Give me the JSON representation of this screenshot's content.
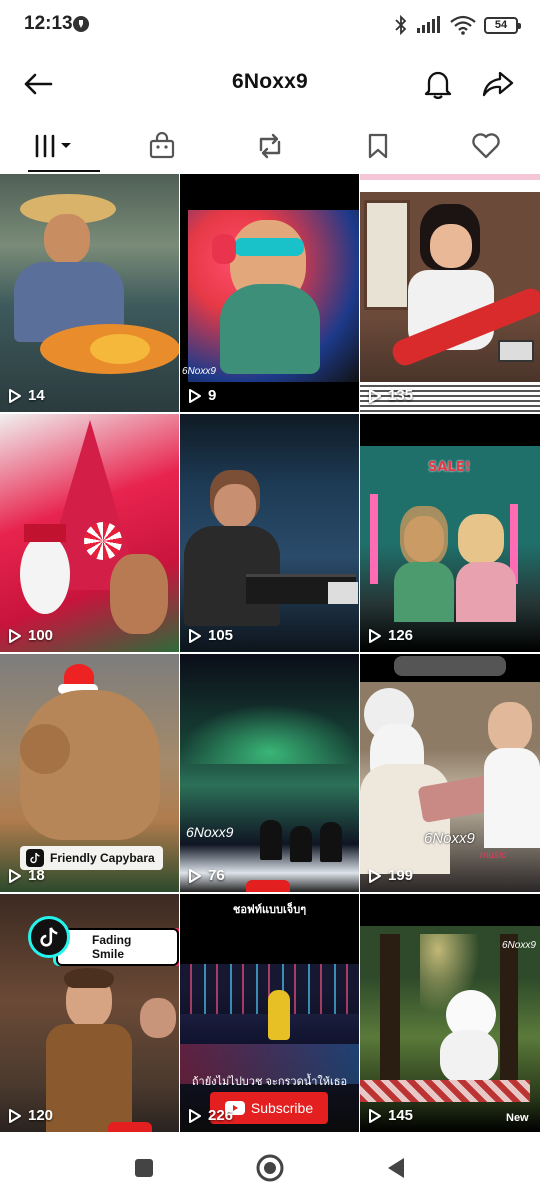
{
  "status_bar": {
    "time": "12:13",
    "battery": "54"
  },
  "header": {
    "title": "6Noxx9"
  },
  "tabs": [
    {
      "name": "videos",
      "icon": "grid-filter-icon",
      "active": true
    },
    {
      "name": "shop",
      "icon": "shopping-bag-icon",
      "active": false
    },
    {
      "name": "reposts",
      "icon": "repost-icon",
      "active": false
    },
    {
      "name": "favorites",
      "icon": "bookmark-icon",
      "active": false
    },
    {
      "name": "liked",
      "icon": "heart-icon",
      "active": false
    }
  ],
  "videos": [
    {
      "views": "14"
    },
    {
      "views": "9",
      "watermark": "6Noxx9"
    },
    {
      "views": "135"
    },
    {
      "views": "100"
    },
    {
      "views": "105"
    },
    {
      "views": "126",
      "overlay_text": "SALE!"
    },
    {
      "views": "18",
      "badge": "Friendly Capybara"
    },
    {
      "views": "76",
      "watermark": "6Noxx9"
    },
    {
      "views": "199",
      "watermark": "6Noxx9",
      "extra": "music"
    },
    {
      "views": "120",
      "badge": "Fading Smile"
    },
    {
      "views": "226",
      "top_text": "ชอฟท์แบบเจ็บๆ",
      "mid_text": "ถ้ายังไม่ไปบวช จะกรวดน้ำให้เธอ",
      "button": "Subscribe"
    },
    {
      "views": "145",
      "watermark": "6Noxx9",
      "extra": "New"
    }
  ],
  "colors": {
    "accent_red": "#e41f1f",
    "tiktok_cyan": "#25f4ee",
    "tiktok_pink": "#fe2c55"
  }
}
